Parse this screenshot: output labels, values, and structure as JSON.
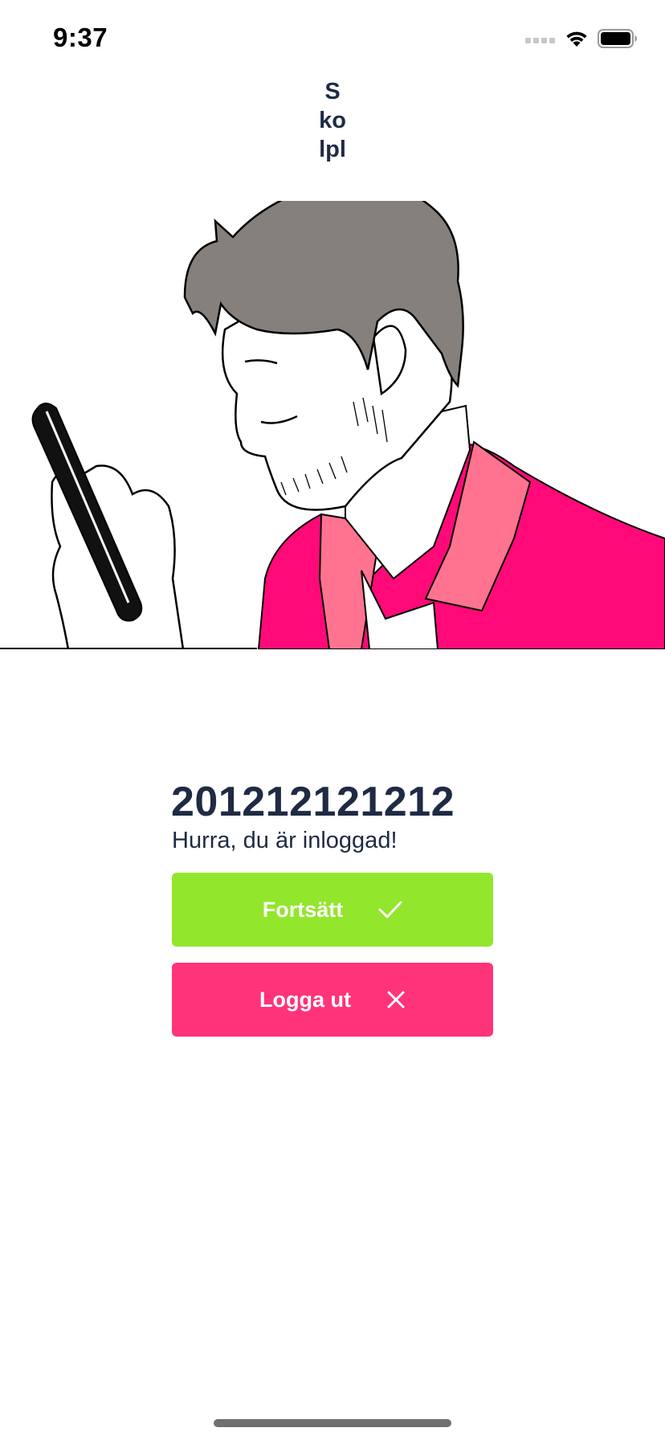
{
  "status_bar": {
    "time": "9:37",
    "icons": [
      "cellular-signal-icon",
      "wifi-icon",
      "battery-icon"
    ]
  },
  "app": {
    "title_lines": [
      "S",
      "ko",
      "lpl"
    ]
  },
  "hero": {
    "illustration": "man-looking-at-phone",
    "colors": {
      "shirt": "#ff0a78",
      "collar": "#ff7390",
      "hair": "#86807d"
    }
  },
  "login": {
    "user_id": "201212121212",
    "message": "Hurra, du är inloggad!",
    "continue_label": "Fortsätt",
    "continue_icon": "checkmark-icon",
    "logout_label": "Logga ut",
    "logout_icon": "close-icon"
  },
  "colors": {
    "text": "#1f2a44",
    "continue_button": "#92e62b",
    "logout_button": "#ff3379",
    "background": "#ffffff"
  }
}
